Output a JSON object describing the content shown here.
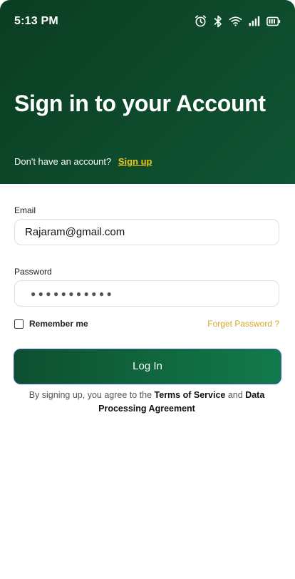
{
  "status_bar": {
    "time": "5:13 PM",
    "icons": [
      "alarm-icon",
      "bluetooth-icon",
      "wifi-icon",
      "signal-icon",
      "battery-icon"
    ]
  },
  "hero": {
    "title": "Sign in to your Account",
    "subtitle": "Don't have an account?",
    "signup_link": "Sign up"
  },
  "form": {
    "email_label": "Email",
    "email_value": "Rajaram@gmail.com",
    "password_label": "Password",
    "password_mask": "●●●●●●●●●●●",
    "remember_label": "Remember me",
    "remember_checked": false,
    "forgot_link": "Forget Password ?",
    "login_button": "Log In"
  },
  "terms": {
    "prefix": "By signing up, you agree to the",
    "terms_link": "Terms of Service",
    "and": "and",
    "dpa_link": "Data Processing Agreement"
  },
  "colors": {
    "hero_bg": "#0b3d22",
    "accent_yellow": "#f0c419",
    "button_green": "#106a40"
  }
}
